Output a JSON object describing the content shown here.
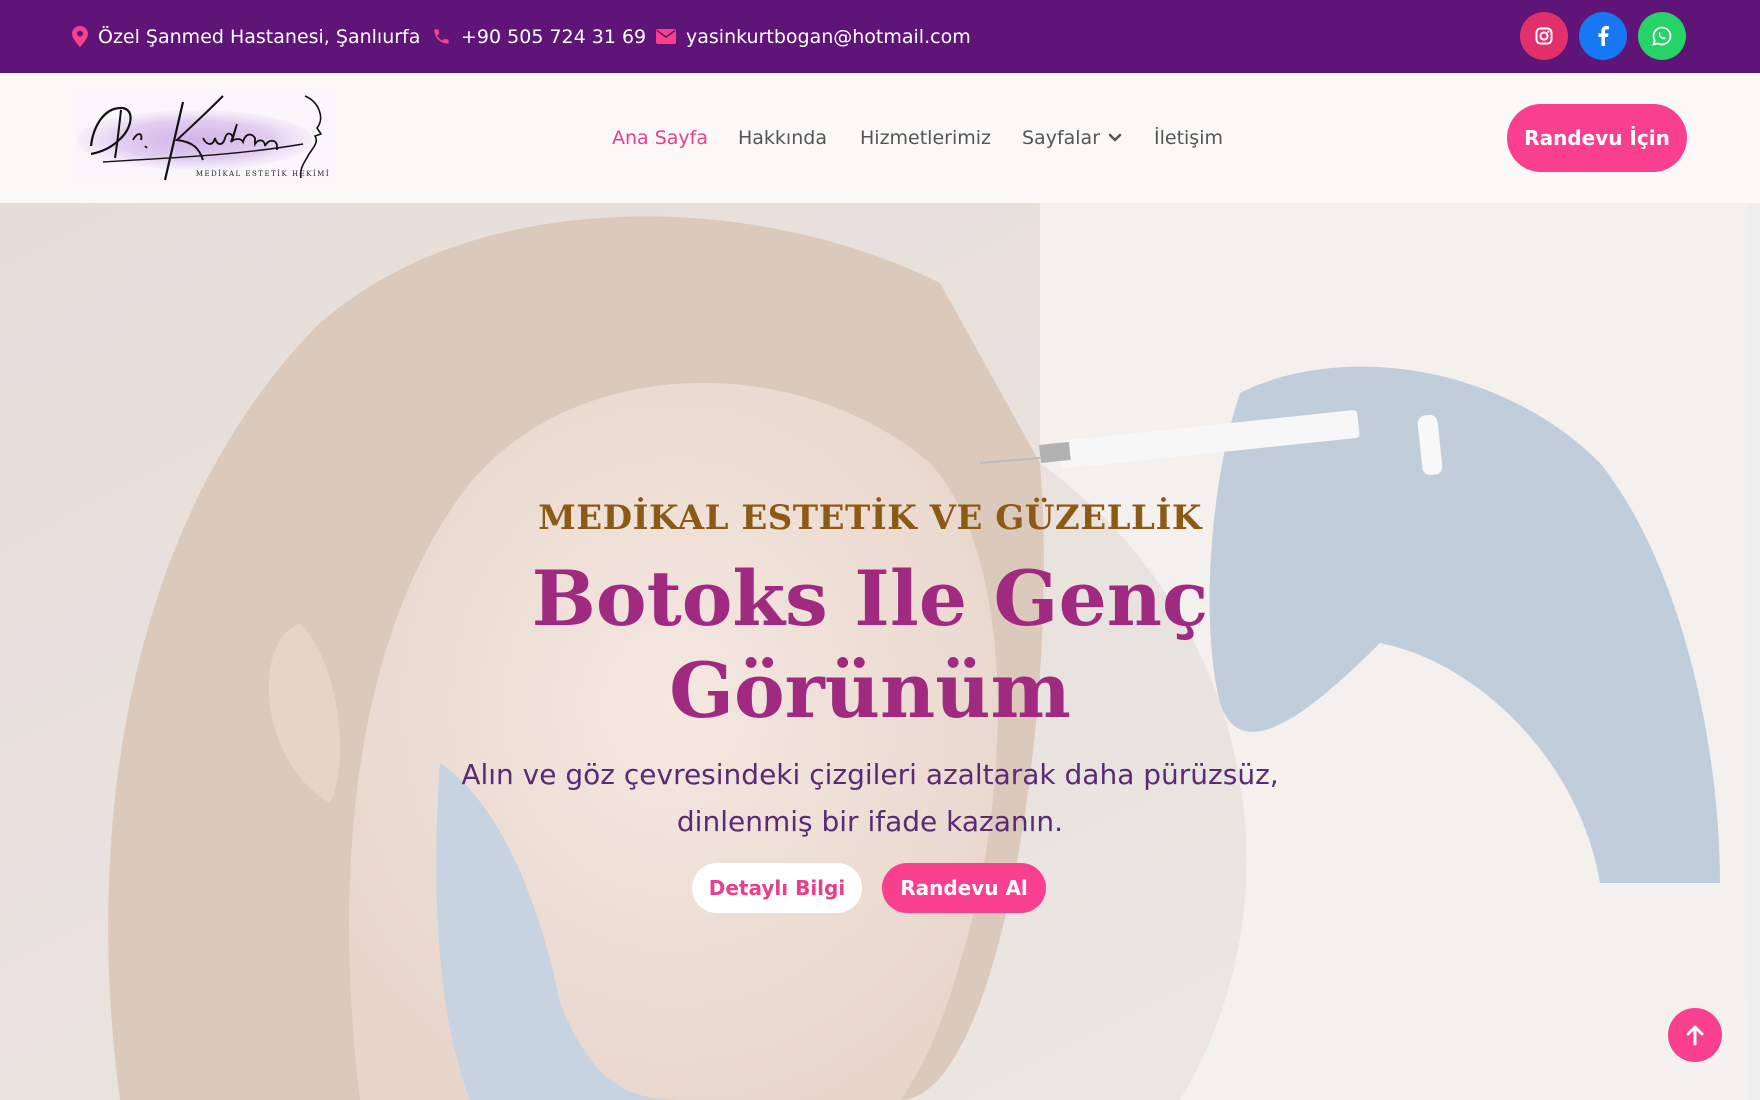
{
  "topbar": {
    "address": "Özel Şanmed Hastanesi, Şanlıurfa",
    "phone": "+90 505 724 31 69",
    "email": "yasinkurtbogan@hotmail.com",
    "social": [
      "instagram-icon",
      "facebook-icon",
      "whatsapp-icon"
    ],
    "social_colors": [
      "#e1306c",
      "#1877f2",
      "#25d366"
    ]
  },
  "logo": {
    "script_text": "Dr.Kurtbogan",
    "subtitle": "MEDİKAL ESTETİK HEKİMİ"
  },
  "nav": {
    "items": [
      "Ana Sayfa",
      "Hakkında",
      "Hizmetlerimiz",
      "Sayfalar",
      "İletişim"
    ],
    "active": "Ana Sayfa",
    "cta": "Randevu İçin"
  },
  "hero": {
    "eyebrow": "MEDİKAL ESTETİK VE GÜZELLİK",
    "title_line1": "Botoks Ile Genç",
    "title_line2": "Görünüm",
    "subtitle_line1": "Alın ve göz çevresindeki çizgileri azaltarak daha pürüzsüz,",
    "subtitle_line2": "dinlenmiş bir ifade kazanın.",
    "btn_info": "Detaylı Bilgi",
    "btn_appointment": "Randevu Al"
  },
  "colors": {
    "topbar": "#5f1578",
    "accent": "#f8408f",
    "eyebrow": "#8b5a14",
    "headline": "#a02a80"
  }
}
